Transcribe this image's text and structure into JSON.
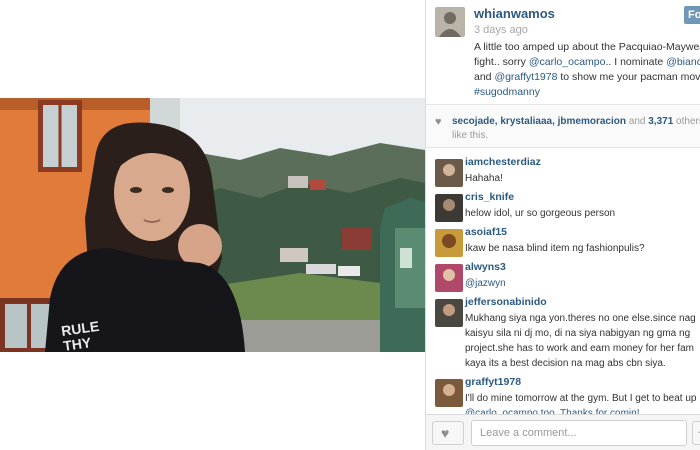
{
  "post": {
    "owner": "whianwamos",
    "time": "3 days ago",
    "follow_label": "Fo",
    "caption": {
      "line1": "A little too amped up about the Pacquiao-Maywea",
      "line2_a": "fight.. sorry ",
      "line2_link": "@carlo_ocampo",
      "line2_b": ".. I nominate ",
      "line2_link2": "@bianca",
      "line3_a": "and ",
      "line3_link": "@graffyt1978",
      "line3_b": " to show me your pacman moves",
      "line4_link": "#sugodmanny"
    }
  },
  "likes": {
    "line1_users": "secojade, krystaliaaa, jbmemoracion",
    "line1_and": " and ",
    "line1_count": "3,371",
    "line1_others": " others",
    "line2": "like this."
  },
  "comments": [
    {
      "user": "iamchesterdiaz",
      "lines": [
        "Hahaha!"
      ],
      "avatar_color": "#6b5a4a"
    },
    {
      "user": "cris_knife",
      "lines": [
        "helow idol, ur so gorgeous person"
      ],
      "avatar_color": "#3d3a36"
    },
    {
      "user": "asoiaf15",
      "lines": [
        "Ikaw be nasa blind item ng fashionpulis?"
      ],
      "avatar_color": "#c99a3a"
    },
    {
      "user": "alwyns3",
      "lines": [
        "@jazwyn"
      ],
      "avatar_color": "#b0486a"
    },
    {
      "user": "jeffersonabinido",
      "lines": [
        "Mukhang siya nga yon.theres no one else.since nag",
        "kaisyu sila ni dj mo, di na siya nabigyan ng gma ng",
        "project.she has to work and earn money for her fam",
        "kaya its a best decision na mag abs cbn siya."
      ],
      "avatar_color": "#4a4640"
    },
    {
      "user": "graffyt1978",
      "lines": [
        "I'll do mine tomorrow at the gym. But I get to beat up",
        "@carlo_ocampo too. Thanks for comin!"
      ],
      "avatar_color": "#7a5a3a"
    }
  ],
  "footer": {
    "placeholder": "Leave a comment...",
    "more_label": "…"
  },
  "icons": {
    "heart": "heart-icon",
    "like": "like-heart-icon"
  }
}
